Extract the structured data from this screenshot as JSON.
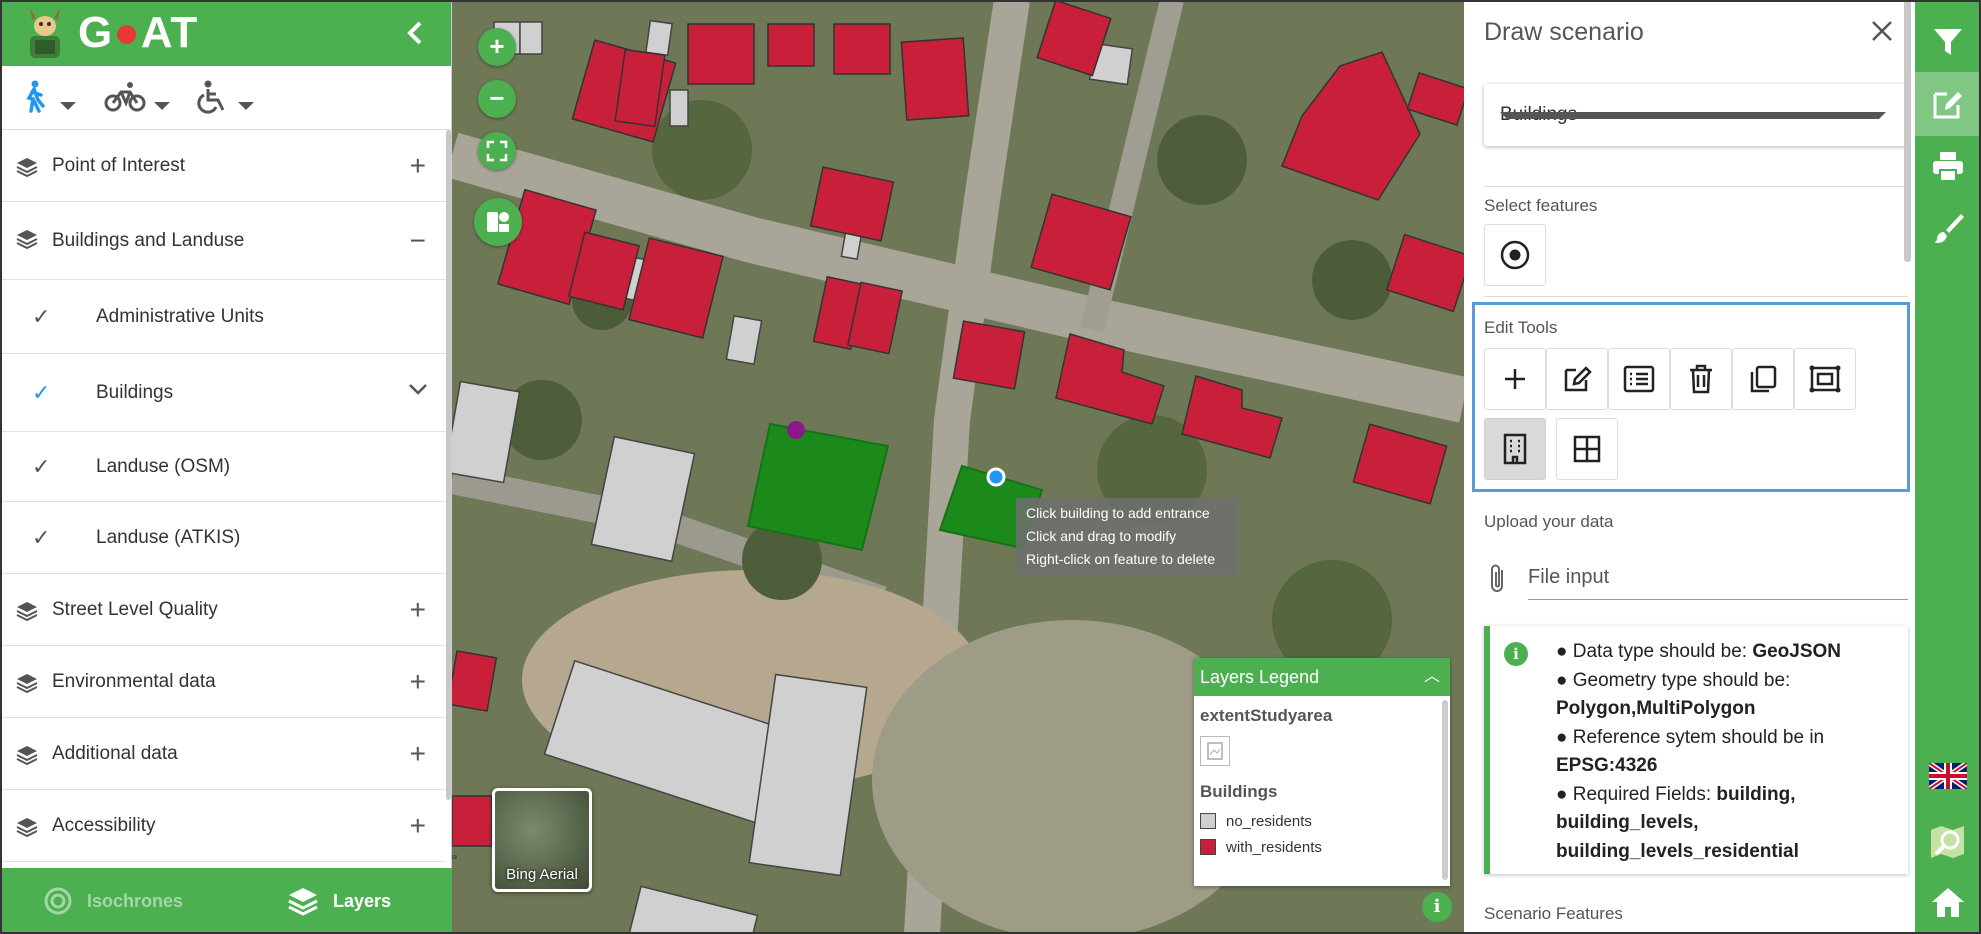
{
  "app": {
    "logo_text_1": "G",
    "logo_text_2": "AT",
    "collapse_icon": "chevron-left-icon"
  },
  "modes": [
    {
      "name": "walking",
      "icon": "walk-icon",
      "active": true
    },
    {
      "name": "cycling",
      "icon": "bike-icon",
      "active": false
    },
    {
      "name": "wheelchair",
      "icon": "wheelchair-icon",
      "active": false
    }
  ],
  "layers": {
    "categories": [
      {
        "label": "Point of Interest",
        "expanded": false
      },
      {
        "label": "Buildings and Landuse",
        "expanded": true
      },
      {
        "label": "Street Level Quality",
        "expanded": false
      },
      {
        "label": "Environmental data",
        "expanded": false
      },
      {
        "label": "Additional data",
        "expanded": false
      },
      {
        "label": "Accessibility",
        "expanded": false
      }
    ],
    "sublayers": [
      {
        "label": "Administrative Units",
        "checked": true,
        "highlight": false
      },
      {
        "label": "Buildings",
        "checked": true,
        "highlight": true
      },
      {
        "label": "Landuse (OSM)",
        "checked": true,
        "highlight": false
      },
      {
        "label": "Landuse (ATKIS)",
        "checked": true,
        "highlight": false
      }
    ]
  },
  "bottom_tabs": {
    "isochrones": "Isochrones",
    "layers": "Layers"
  },
  "map": {
    "zoom_in": "+",
    "zoom_out": "−",
    "basemap_label": "Bing Aerial",
    "tooltip": [
      "Click building to add entrance",
      "Click and drag to modify",
      "Right-click on feature to delete"
    ],
    "legend": {
      "title": "Layers Legend",
      "group1": "extentStudyarea",
      "group2": "Buildings",
      "items": [
        {
          "label": "no_residents",
          "color": "#d0d0d0"
        },
        {
          "label": "with_residents",
          "color": "#c8203a"
        }
      ]
    },
    "info": "i"
  },
  "draw": {
    "title": "Draw scenario",
    "layer_value": "Buildings",
    "select_features_label": "Select features",
    "edit_tools_label": "Edit Tools",
    "upload_label": "Upload your data",
    "file_input_placeholder": "File input",
    "info_lines": {
      "l1a": "● Data type should be: ",
      "l1b": "GeoJSON",
      "l2a": "● Geometry type should be: ",
      "l2b": "Polygon,MultiPolygon",
      "l3a": "● Reference sytem should be in ",
      "l3b": "EPSG:4326",
      "l4a": "● Required Fields: ",
      "l4b": "building, building_levels, building_levels_residential"
    },
    "scenario_features_label": "Scenario Features"
  },
  "colors": {
    "green": "#4caf50",
    "building_res": "#c8203a",
    "building_nores": "#d0d0d0",
    "edit_highlight": "#5b9bd5"
  }
}
